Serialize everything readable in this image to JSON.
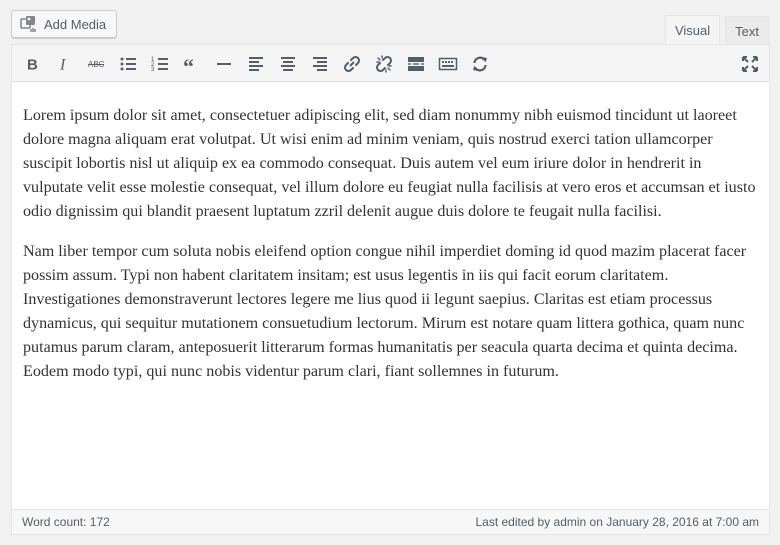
{
  "media": {
    "add_media_label": "Add Media",
    "icon": "add-media-icon"
  },
  "tabs": [
    {
      "label": "Visual",
      "active": true
    },
    {
      "label": "Text",
      "active": false
    }
  ],
  "toolbar": {
    "buttons": [
      "bold",
      "italic",
      "strikethrough",
      "bullet-list",
      "numbered-list",
      "blockquote",
      "horizontal-line",
      "align-left",
      "align-center",
      "align-right",
      "insert-link",
      "remove-link",
      "read-more",
      "toolbar-toggle",
      "refresh"
    ],
    "fullscreen": "fullscreen"
  },
  "content": {
    "paragraphs": [
      "Lorem ipsum dolor sit amet, consectetuer adipiscing elit, sed diam nonummy nibh euismod tincidunt ut laoreet dolore magna aliquam erat volutpat. Ut wisi enim ad minim veniam, quis nostrud exerci tation ullamcorper suscipit lobortis nisl ut aliquip ex ea commodo consequat. Duis autem vel eum iriure dolor in hendrerit in vulputate velit esse molestie consequat, vel illum dolore eu feugiat nulla facilisis at vero eros et accumsan et iusto odio dignissim qui blandit praesent luptatum zzril delenit augue duis dolore te feugait nulla facilisi.",
      "Nam liber tempor cum soluta nobis eleifend option congue nihil imperdiet doming id quod mazim placerat facer possim assum. Typi non habent claritatem insitam; est usus legentis in iis qui facit eorum claritatem. Investigationes demonstraverunt lectores legere me lius quod ii legunt saepius. Claritas est etiam processus dynamicus, qui sequitur mutationem consuetudium lectorum. Mirum est notare quam littera gothica, quam nunc putamus parum claram, anteposuerit litterarum formas humanitatis per seacula quarta decima et quinta decima. Eodem modo typi, qui nunc nobis videntur parum clari, fiant sollemnes in futurum."
    ]
  },
  "status": {
    "word_count": "Word count: 172",
    "last_edited": "Last edited by admin on January 28, 2016 at 7:00 am"
  }
}
